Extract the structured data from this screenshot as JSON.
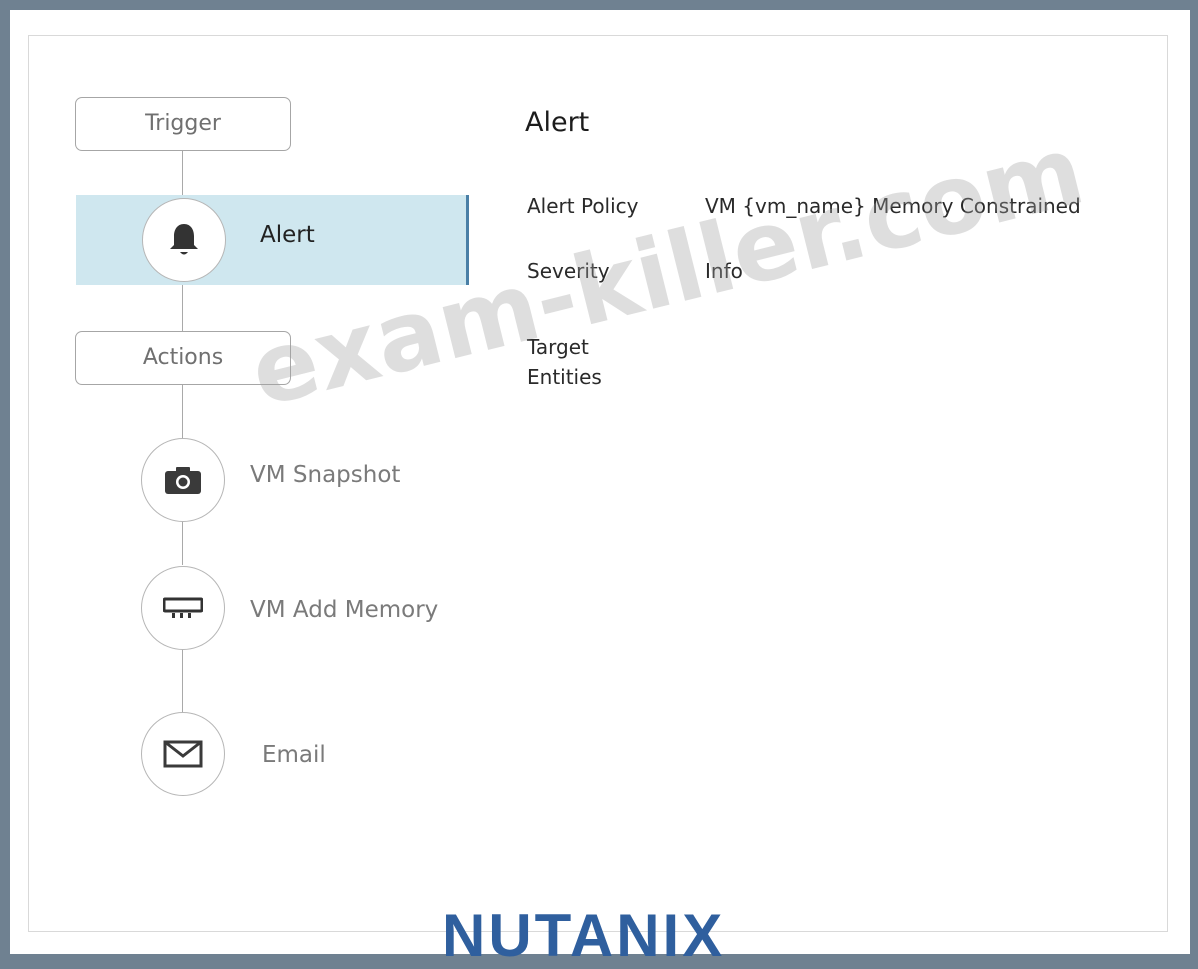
{
  "flow": {
    "trigger_label": "Trigger",
    "actions_label": "Actions",
    "trigger_item": {
      "label": "Alert",
      "icon": "bell-icon"
    },
    "action_items": [
      {
        "label": "VM Snapshot",
        "icon": "camera-icon"
      },
      {
        "label": "VM Add Memory",
        "icon": "memory-icon"
      },
      {
        "label": "Email",
        "icon": "mail-icon"
      }
    ]
  },
  "details": {
    "title": "Alert",
    "fields": [
      {
        "label": "Alert Policy",
        "value": "VM {vm_name} Memory Constrained"
      },
      {
        "label": "Severity",
        "value": "Info"
      },
      {
        "label": "Target Entities",
        "value": ""
      }
    ]
  },
  "watermark": "exam-killer.com",
  "logo": "NUTANIX",
  "colors": {
    "selected_bg": "#cfe7ef",
    "selected_accent": "#4a7fa6",
    "logo": "#2f5f9e"
  }
}
